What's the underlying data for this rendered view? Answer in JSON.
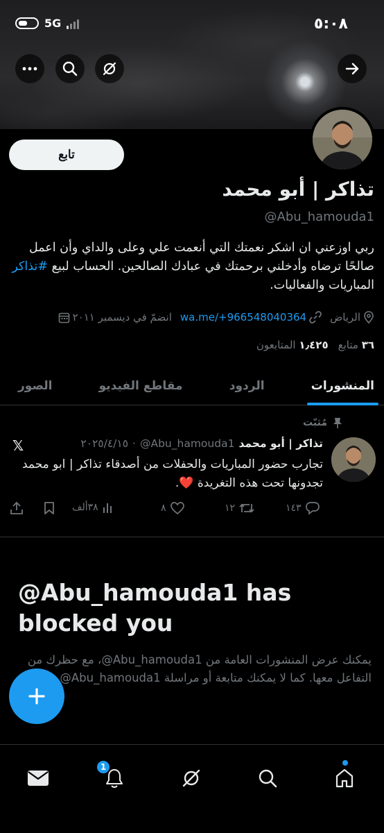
{
  "status_bar": {
    "time": "٥:٠٨",
    "network": "5G"
  },
  "profile": {
    "name": "تذاكر | أبو محمد",
    "handle": "@Abu_hamouda1",
    "bio_text": "ربي اوزعني ان اشكر نعمتك التي أنعمت علي وعلى والداي وأن اعمل صالحًا ترضاه وأدخلني برحمتك في عبادك الصالحين. الحساب لبيع ",
    "bio_hashtag": "#تذاكر",
    "bio_tail": " المباريات والفعاليات.",
    "location": "الرياض",
    "link": "wa.me/+966548040364",
    "joined": "انضمّ في ديسمبر ٢٠١١",
    "following_count": "٣٦",
    "following_label": "متابع",
    "followers_count": "١٫٤٢٥",
    "followers_label": "المتابعون"
  },
  "follow_button": "تابع",
  "tabs": [
    {
      "label": "المنشورات",
      "active": true
    },
    {
      "label": "الردود",
      "active": false
    },
    {
      "label": "مقاطع الفيديو",
      "active": false
    },
    {
      "label": "الصور",
      "active": false
    }
  ],
  "pinned_tweet": {
    "pinned_label": "مُثبّت",
    "author": "تذاكر | أبو محمد",
    "handle": "@Abu_hamouda1",
    "date": "٢٠٢٥/٤/١٥",
    "text": "تجارب حضور المباريات والحفلات من أصدقاء تذاكر | ابو محمد تجدونها تحت هذه التغريدة ❤️.",
    "replies": "١٤٣",
    "retweets": "١٢",
    "likes": "٨",
    "views": "٣٨ألف"
  },
  "blocked": {
    "title": "@Abu_hamouda1 has blocked you",
    "message": "يمكنك عرض المنشورات العامة من Abu_hamouda1@، مع حظرك من التفاعل معها. كما لا يمكنك متابعة أو مراسلة Abu_hamouda1@."
  },
  "bottom_nav": {
    "notification_badge": "1"
  },
  "colors": {
    "accent": "#1d9bf0",
    "background": "#000000",
    "text": "#e7e9ea",
    "muted": "#71767b",
    "like": "#f91880"
  }
}
